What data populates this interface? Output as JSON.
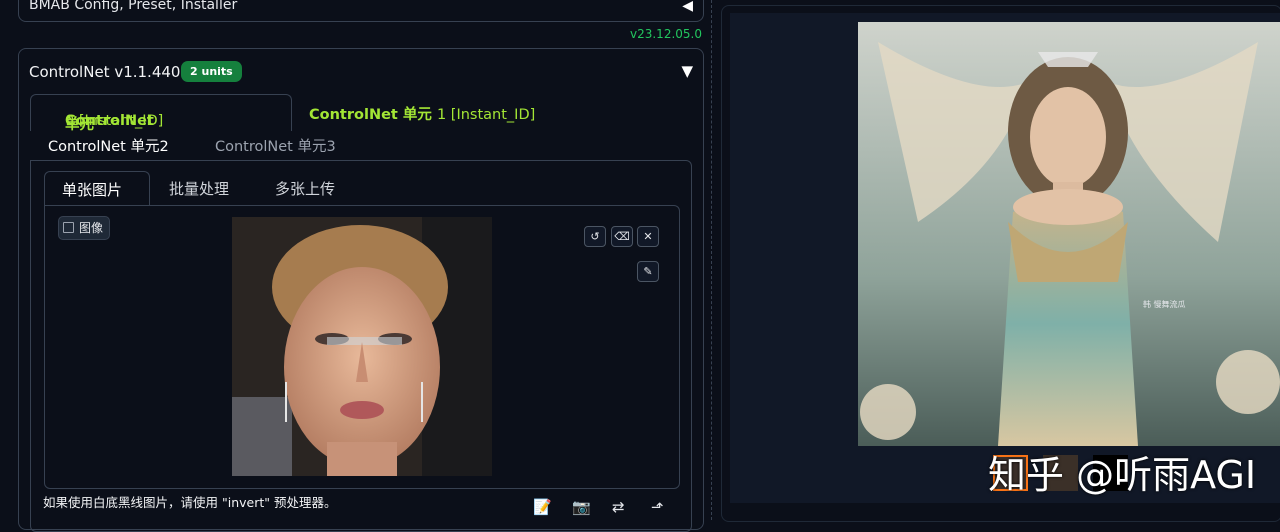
{
  "top_panel": {
    "title": "BMAB Config, Preset, Installer"
  },
  "version": "v23.12.05.0",
  "controlnet": {
    "header": "ControlNet v1.1.440",
    "badge": "2 units",
    "units": [
      {
        "prefix": "ControlNet ",
        "zh": "单元",
        "suffix": "0 [Instant_ID]"
      },
      {
        "prefix": "ControlNet ",
        "zh": "单元",
        "suffix": "1 [Instant_ID]"
      },
      {
        "label": "ControlNet 单元2"
      },
      {
        "label": "ControlNet 单元3"
      }
    ],
    "sub_tabs": [
      "单张图片",
      "批量处理",
      "多张上传"
    ],
    "image_label": "图像",
    "hint": "如果使用白底黑线图片，请使用 \"invert\" 预处理器。"
  },
  "gallery": {
    "image_signature": "韩 慢舞流瓜",
    "watermark": "知乎 @听雨AGI"
  },
  "icons": {
    "undo": "undo-icon",
    "erase": "eraser-icon",
    "clear": "close-icon",
    "brush": "brush-icon",
    "edit": "edit-icon",
    "camera": "camera-icon",
    "swap": "swap-icon",
    "send": "send-icon"
  },
  "colors": {
    "accent_green": "#a3e635",
    "badge_green": "#15803d",
    "version_green": "#22c55e",
    "thumb_selected": "#f97316"
  }
}
